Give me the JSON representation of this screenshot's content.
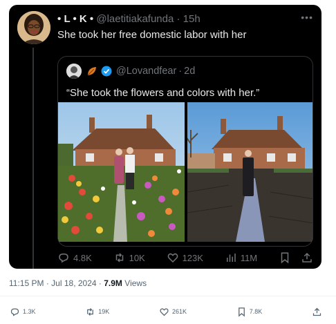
{
  "tweet": {
    "display_name": "L • K",
    "bullet": "•",
    "handle": "@laetitiakafunda",
    "separator": "·",
    "time": "15h",
    "text": "She took her free domestic labor with her",
    "more_icon": "more-dots-icon"
  },
  "quote": {
    "handle": "@Lovandfear",
    "separator": "·",
    "time": "2d",
    "text": "“She took the flowers and colors with her.”",
    "verified_color": "#1d9bf0",
    "images": [
      {
        "name": "couple-in-flower-garden-photo"
      },
      {
        "name": "man-alone-in-bare-garden-photo"
      }
    ]
  },
  "actions": {
    "replies": "4.8K",
    "retweets": "10K",
    "likes": "123K",
    "views": "11M"
  },
  "meta": {
    "time": "11:15 PM",
    "separator": "·",
    "date": "Jul 18, 2024",
    "views_count": "7.9M",
    "views_label": "Views"
  },
  "footer": {
    "replies": "1.3K",
    "retweets": "19K",
    "likes": "261K",
    "bookmarks": "7.8K"
  },
  "colors": {
    "card_bg": "#000000",
    "text_light": "#e7e9ea",
    "text_muted": "#71767b",
    "accent": "#1d9bf0"
  }
}
